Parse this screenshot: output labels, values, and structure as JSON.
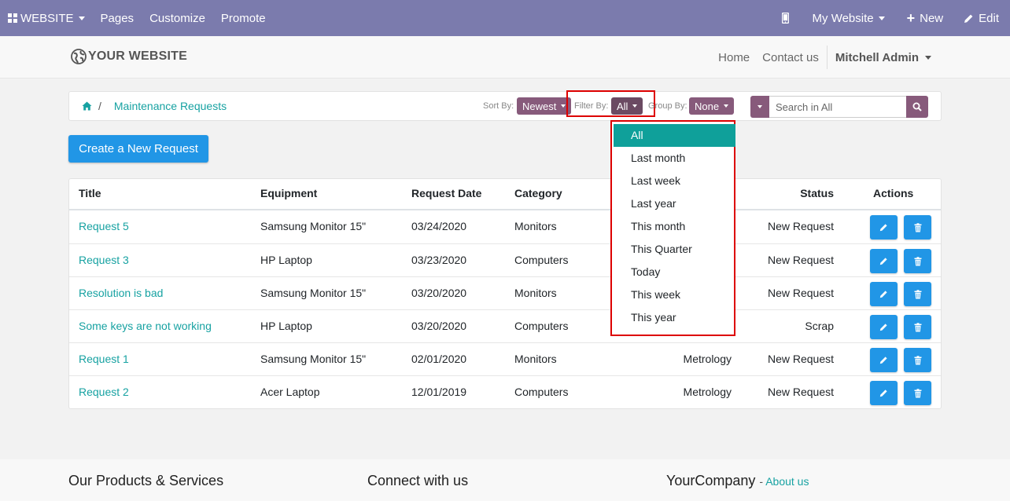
{
  "admin_bar": {
    "website_label": "WEBSITE",
    "menu": [
      "Pages",
      "Customize",
      "Promote"
    ],
    "my_website": "My Website",
    "new_label": "New",
    "edit_label": "Edit"
  },
  "header": {
    "logo_text": "YOUR WEBSITE",
    "nav": [
      "Home",
      "Contact us"
    ],
    "user": "Mitchell Admin"
  },
  "breadcrumb": {
    "current": "Maintenance Requests"
  },
  "controls": {
    "sort_label": "Sort By:",
    "sort_value": "Newest",
    "filter_label": "Filter By:",
    "filter_value": "All",
    "group_label": "Group By:",
    "group_value": "None",
    "search_placeholder": "Search in All"
  },
  "create_button": "Create a New Request",
  "table": {
    "headers": [
      "Title",
      "Equipment",
      "Request Date",
      "Category",
      "Status",
      "Actions"
    ],
    "rows": [
      {
        "title": "Request 5",
        "equipment": "Samsung Monitor 15\"",
        "date": "03/24/2020",
        "category": "Monitors",
        "team": "",
        "status": "New Request"
      },
      {
        "title": "Request 3",
        "equipment": "HP Laptop",
        "date": "03/23/2020",
        "category": "Computers",
        "team": "",
        "status": "New Request"
      },
      {
        "title": "Resolution is bad",
        "equipment": "Samsung Monitor 15\"",
        "date": "03/20/2020",
        "category": "Monitors",
        "team": "",
        "status": "New Request"
      },
      {
        "title": "Some keys are not working",
        "equipment": "HP Laptop",
        "date": "03/20/2020",
        "category": "Computers",
        "team": "",
        "status": "Scrap"
      },
      {
        "title": "Request 1",
        "equipment": "Samsung Monitor 15\"",
        "date": "02/01/2020",
        "category": "Monitors",
        "team": "Metrology",
        "status": "New Request"
      },
      {
        "title": "Request 2",
        "equipment": "Acer Laptop",
        "date": "12/01/2019",
        "category": "Computers",
        "team": "Metrology",
        "status": "New Request"
      }
    ]
  },
  "filter_dropdown": {
    "options": [
      "All",
      "Last month",
      "Last week",
      "Last year",
      "This month",
      "This Quarter",
      "Today",
      "This week",
      "This year"
    ],
    "selected": "All"
  },
  "footer": {
    "col1_title": "Our Products & Services",
    "col2_title": "Connect with us",
    "col3_title": "YourCompany",
    "col3_link": "About us"
  },
  "colors": {
    "admin_bar": "#7b7bad",
    "brand_purple": "#875a7b",
    "link_teal": "#17a2a2",
    "primary_blue": "#2196e6",
    "dropdown_active": "#0fa09a",
    "highlight_red": "#dd0000"
  }
}
